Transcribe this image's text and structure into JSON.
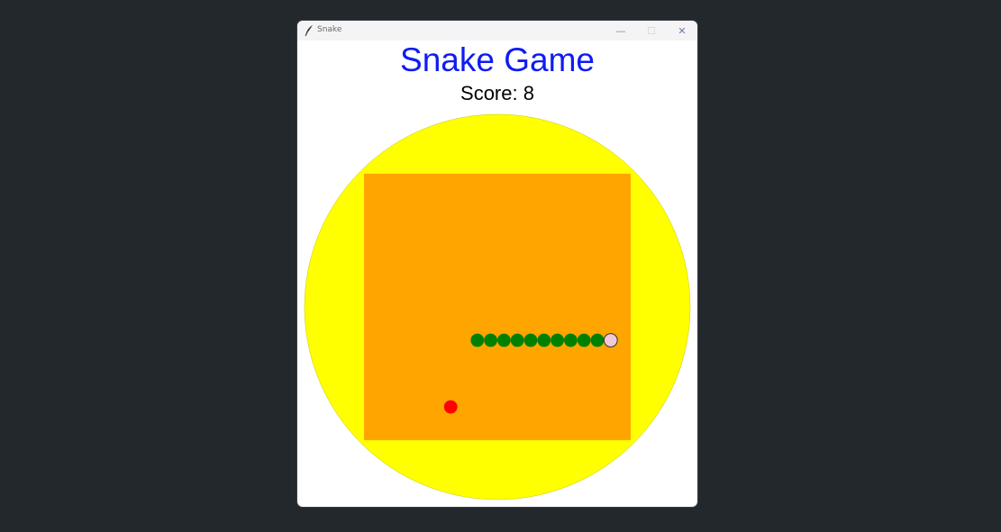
{
  "window": {
    "title": "Snake",
    "icon": "feather-icon",
    "controls": {
      "minimize": "—",
      "maximize": "☐",
      "close": "✕"
    }
  },
  "game": {
    "title": "Snake Game",
    "score_label": "Score:",
    "score": 8
  },
  "colors": {
    "background": "#23282d",
    "title": "#0f1cf2",
    "arena": "#ffff00",
    "board": "#ffa500",
    "snake_body": "#008000",
    "snake_head": "#f0c8d8",
    "food": "#ff0000"
  },
  "grid": {
    "columns": 20,
    "rows": 20
  },
  "snake": {
    "head": [
      18,
      12
    ],
    "body": [
      [
        17,
        12
      ],
      [
        16,
        12
      ],
      [
        15,
        12
      ],
      [
        14,
        12
      ],
      [
        13,
        12
      ],
      [
        12,
        12
      ],
      [
        11,
        12
      ],
      [
        10,
        12
      ],
      [
        9,
        12
      ],
      [
        8,
        12
      ]
    ]
  },
  "food": [
    6,
    17
  ]
}
